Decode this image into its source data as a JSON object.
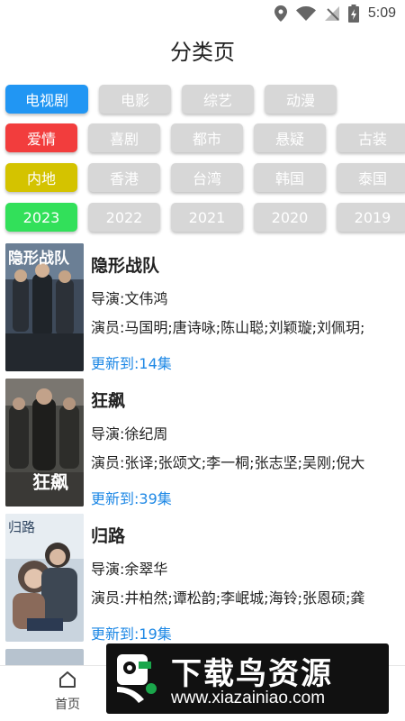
{
  "status_bar": {
    "time": "5:09"
  },
  "page_title": "分类页",
  "colors": {
    "active_type": "#2196f3",
    "active_genre": "#f23d3d",
    "active_region": "#d4c300",
    "active_year": "#32e05a",
    "inactive": "#d7d7d7",
    "update_text": "#1e88e5"
  },
  "filters": {
    "types": {
      "selected": "电视剧",
      "options": [
        "电视剧",
        "电影",
        "综艺",
        "动漫"
      ]
    },
    "genres": {
      "selected": "爱情",
      "options": [
        "爱情",
        "喜剧",
        "都市",
        "悬疑",
        "古装"
      ]
    },
    "regions": {
      "selected": "内地",
      "options": [
        "内地",
        "香港",
        "台湾",
        "韩国",
        "泰国"
      ]
    },
    "years": {
      "selected": "2023",
      "options": [
        "2023",
        "2022",
        "2021",
        "2020",
        "2019"
      ]
    }
  },
  "shows": [
    {
      "title": "隐形战队",
      "poster_text": "隐形战队",
      "director": "导演:文伟鸿",
      "actors": "演员:马国明;唐诗咏;陈山聪;刘颖璇;刘佩玥;",
      "update": "更新到:14集"
    },
    {
      "title": "狂飙",
      "poster_text": "狂飙",
      "director": "导演:徐纪周",
      "actors": "演员:张译;张颂文;李一桐;张志坚;吴刚;倪大",
      "update": "更新到:39集"
    },
    {
      "title": "归路",
      "poster_text": "归路",
      "director": "导演:余翠华",
      "actors": "演员:井柏然;谭松韵;李岷城;海铃;张恩硕;龚",
      "update": "更新到:19集"
    }
  ],
  "bottom_nav": {
    "home_label": "首页",
    "home_icon": "home-icon"
  },
  "watermark": {
    "title": "下载鸟资源",
    "url": "www.xiazainiao.com"
  }
}
